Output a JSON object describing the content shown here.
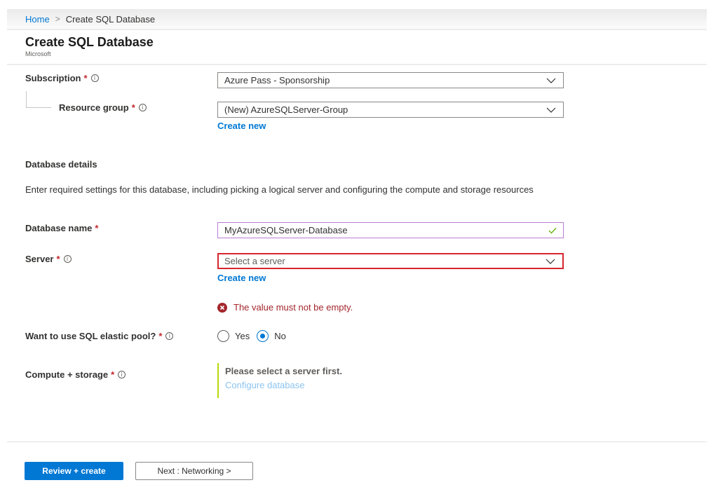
{
  "breadcrumb": {
    "home": "Home",
    "separator": ">",
    "current": "Create SQL Database"
  },
  "header": {
    "title": "Create SQL Database",
    "subtitle": "Microsoft"
  },
  "project": {
    "subscription": {
      "label": "Subscription",
      "required": "*",
      "info": "i",
      "value": "Azure Pass - Sponsorship"
    },
    "resource_group": {
      "label": "Resource group",
      "required": "*",
      "info": "i",
      "value": "(New) AzureSQLServer-Group",
      "create_new": "Create new"
    }
  },
  "database_details": {
    "heading": "Database details",
    "description": "Enter required settings for this database, including picking a logical server and configuring the compute and storage resources",
    "database_name": {
      "label": "Database name",
      "required": "*",
      "value": "MyAzureSQLServer-Database"
    },
    "server": {
      "label": "Server",
      "required": "*",
      "info": "i",
      "placeholder": "Select a server",
      "create_new": "Create new",
      "error": "The value must not be empty."
    },
    "elastic_pool": {
      "label": "Want to use SQL elastic pool?",
      "required": "*",
      "info": "i",
      "options": [
        "Yes",
        "No"
      ],
      "selected": "No"
    },
    "compute_storage": {
      "label": "Compute + storage",
      "required": "*",
      "info": "i",
      "message": "Please select a server first.",
      "link": "Configure database"
    }
  },
  "footer": {
    "primary_button": "Review + create",
    "next_button": "Next : Networking >"
  },
  "colors": {
    "accent": "#0078d4",
    "error": "#a4262c",
    "valid": "#5db300",
    "info_bar": "#bad80a"
  }
}
